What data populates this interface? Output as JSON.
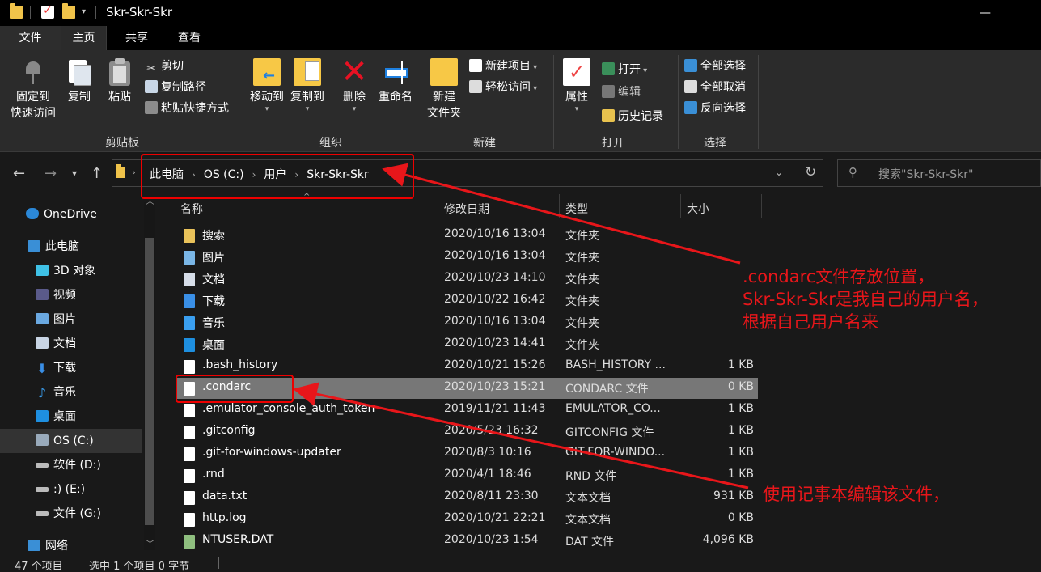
{
  "window": {
    "title": "Skr-Skr-Skr"
  },
  "ribbon_tabs": [
    "文件",
    "主页",
    "共享",
    "查看"
  ],
  "ribbon": {
    "clipboard": {
      "pin_line1": "固定到",
      "pin_line2": "快速访问",
      "copy": "复制",
      "paste": "粘贴",
      "cut": "剪切",
      "copy_path": "复制路径",
      "paste_shortcut": "粘贴快捷方式",
      "group": "剪贴板"
    },
    "organize": {
      "move_to": "移动到",
      "copy_to": "复制到",
      "delete": "删除",
      "rename": "重命名",
      "group": "组织"
    },
    "new": {
      "new_folder_line1": "新建",
      "new_folder_line2": "文件夹",
      "new_item": "新建项目",
      "easy_access": "轻松访问",
      "group": "新建"
    },
    "open": {
      "properties": "属性",
      "open": "打开",
      "edit": "编辑",
      "history": "历史记录",
      "group": "打开"
    },
    "select": {
      "select_all": "全部选择",
      "select_none": "全部取消",
      "invert": "反向选择",
      "group": "选择"
    }
  },
  "address": {
    "crumbs": [
      "此电脑",
      "OS (C:)",
      "用户",
      "Skr-Skr-Skr"
    ],
    "search_placeholder": "搜索\"Skr-Skr-Skr\""
  },
  "sidebar": {
    "items": [
      {
        "label": "OneDrive",
        "icon": "cloud-icon",
        "color": "#2b88d8"
      },
      {
        "label": "此电脑",
        "icon": "computer-icon",
        "color": "#3a8fd6"
      },
      {
        "label": "3D 对象",
        "icon": "cube-icon",
        "color": "#3fc1e6"
      },
      {
        "label": "视频",
        "icon": "video-icon",
        "color": "#5a5a8a"
      },
      {
        "label": "图片",
        "icon": "picture-icon",
        "color": "#6aa8e0"
      },
      {
        "label": "文档",
        "icon": "document-icon",
        "color": "#c8d4e4"
      },
      {
        "label": "下载",
        "icon": "download-icon",
        "color": "#3a8fe6"
      },
      {
        "label": "音乐",
        "icon": "music-icon",
        "color": "#3a9ff0"
      },
      {
        "label": "桌面",
        "icon": "desktop-icon",
        "color": "#1e8fe0"
      },
      {
        "label": "OS (C:)",
        "icon": "drive-c-icon",
        "color": "#9ab"
      },
      {
        "label": "软件 (D:)",
        "icon": "drive-icon",
        "color": "#bbb"
      },
      {
        "label": ":) (E:)",
        "icon": "drive-icon",
        "color": "#bbb"
      },
      {
        "label": "文件 (G:)",
        "icon": "drive-icon",
        "color": "#bbb"
      },
      {
        "label": "网络",
        "icon": "network-icon",
        "color": "#3a8fd6"
      }
    ]
  },
  "columns": {
    "name": "名称",
    "date": "修改日期",
    "type": "类型",
    "size": "大小"
  },
  "files": [
    {
      "name": "搜索",
      "date": "2020/10/16 13:04",
      "type": "文件夹",
      "size": "",
      "icon": "search-folder-icon",
      "color": "#e9c25a"
    },
    {
      "name": "图片",
      "date": "2020/10/16 13:04",
      "type": "文件夹",
      "size": "",
      "icon": "pictures-folder-icon",
      "color": "#7ab6e6"
    },
    {
      "name": "文档",
      "date": "2020/10/23 14:10",
      "type": "文件夹",
      "size": "",
      "icon": "documents-folder-icon",
      "color": "#d6dde8"
    },
    {
      "name": "下载",
      "date": "2020/10/22 16:42",
      "type": "文件夹",
      "size": "",
      "icon": "downloads-folder-icon",
      "color": "#3a8fe6"
    },
    {
      "name": "音乐",
      "date": "2020/10/16 13:04",
      "type": "文件夹",
      "size": "",
      "icon": "music-folder-icon",
      "color": "#3a9ff0"
    },
    {
      "name": "桌面",
      "date": "2020/10/23 14:41",
      "type": "文件夹",
      "size": "",
      "icon": "desktop-folder-icon",
      "color": "#1e8fe0"
    },
    {
      "name": ".bash_history",
      "date": "2020/10/21 15:26",
      "type": "BASH_HISTORY ...",
      "size": "1 KB",
      "icon": "file-icon",
      "color": "#ffffff"
    },
    {
      "name": ".condarc",
      "date": "2020/10/23 15:21",
      "type": "CONDARC 文件",
      "size": "0 KB",
      "icon": "file-icon",
      "color": "#ffffff"
    },
    {
      "name": ".emulator_console_auth_token",
      "date": "2019/11/21 11:43",
      "type": "EMULATOR_CO...",
      "size": "1 KB",
      "icon": "file-icon",
      "color": "#ffffff"
    },
    {
      "name": ".gitconfig",
      "date": "2020/5/23 16:32",
      "type": "GITCONFIG 文件",
      "size": "1 KB",
      "icon": "file-icon",
      "color": "#ffffff"
    },
    {
      "name": ".git-for-windows-updater",
      "date": "2020/8/3 10:16",
      "type": "GIT-FOR-WINDO...",
      "size": "1 KB",
      "icon": "file-icon",
      "color": "#ffffff"
    },
    {
      "name": ".rnd",
      "date": "2020/4/1 18:46",
      "type": "RND 文件",
      "size": "1 KB",
      "icon": "file-icon",
      "color": "#ffffff"
    },
    {
      "name": "data.txt",
      "date": "2020/8/11 23:30",
      "type": "文本文档",
      "size": "931 KB",
      "icon": "text-file-icon",
      "color": "#ffffff"
    },
    {
      "name": "http.log",
      "date": "2020/10/21 22:21",
      "type": "文本文档",
      "size": "0 KB",
      "icon": "text-file-icon",
      "color": "#ffffff"
    },
    {
      "name": "NTUSER.DAT",
      "date": "2020/10/23 1:54",
      "type": "DAT 文件",
      "size": "4,096 KB",
      "icon": "dat-file-icon",
      "color": "#8fbf7f"
    }
  ],
  "status": {
    "count": "47 个项目",
    "selected": "选中 1 个项目  0 字节"
  },
  "annotations": {
    "note1_line1": ".condarc文件存放位置，",
    "note1_line2": "Skr-Skr-Skr是我自己的用户名，",
    "note1_line3": "根据自己用户名来",
    "note2": "使用记事本编辑该文件，",
    "color": "#e8161a"
  }
}
